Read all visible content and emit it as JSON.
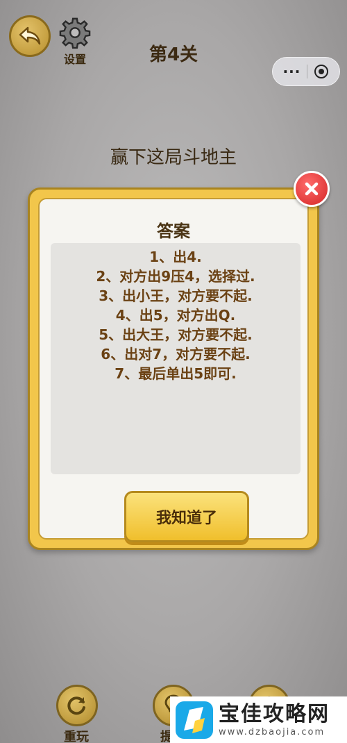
{
  "header": {
    "settings_label": "设置",
    "level_title": "第4关"
  },
  "capsule": {
    "more_symbol": "···"
  },
  "task": {
    "text": "赢下这局斗地主"
  },
  "dialog": {
    "title": "答案",
    "answer_lines": [
      "1、出4.",
      "2、对方出9压4，选择过.",
      "3、出小王，对方要不起.",
      "4、出5，对方出Q.",
      "5、出大王，对方要不起.",
      "6、出对7，对方要不起.",
      "7、最后单出5即可."
    ],
    "ok_label": "我知道了"
  },
  "bottom": {
    "replay_label": "重玩",
    "hint_label": "提"
  },
  "watermark": {
    "name": "宝佳攻略网",
    "url": "www.dzbaojia.com"
  },
  "colors": {
    "background": "#a9a7a7",
    "dialog_border": "#f2c64b",
    "answer_text": "#6b4214",
    "close_red": "#d42525"
  }
}
